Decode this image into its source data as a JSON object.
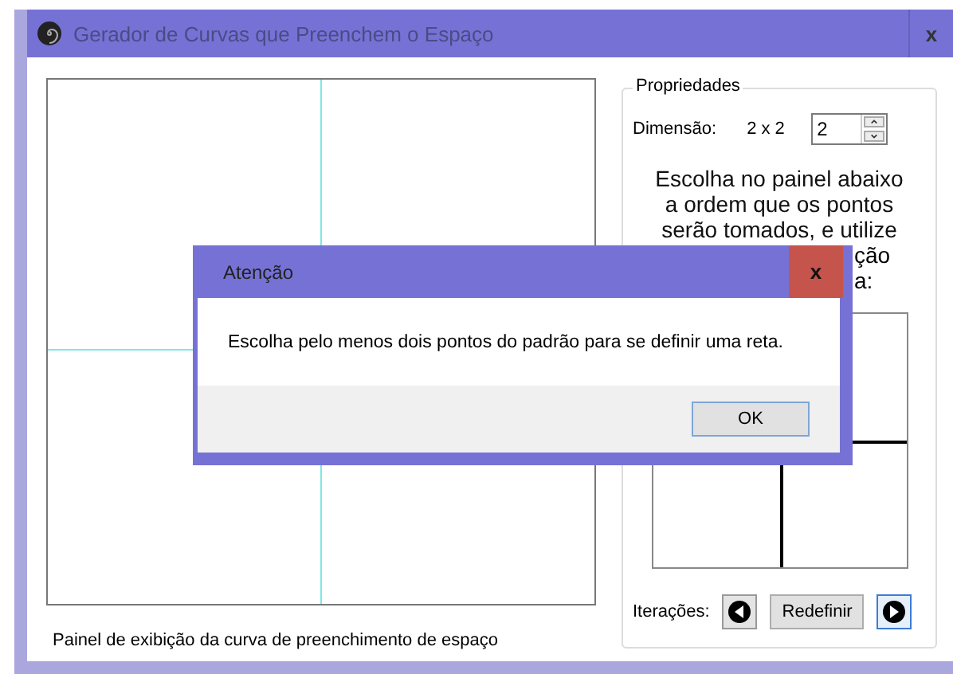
{
  "window": {
    "title": "Gerador de Curvas que Preenchem o Espaço",
    "close": "x"
  },
  "display_panel": {
    "caption": "Painel de exibição da curva de preenchimento de espaço"
  },
  "properties": {
    "title": "Propriedades",
    "dimension_label": "Dimensão:",
    "dimension_value": "2 x 2",
    "spinner_value": "2",
    "instructions": [
      "Escolha no painel abaixo",
      "a ordem que os pontos",
      "serão tomados, e utilize"
    ],
    "instruction_fragments": [
      "ção",
      "a:"
    ],
    "iterations_label": "Iterações:",
    "reset_button": "Redefinir"
  },
  "dialog": {
    "title": "Atenção",
    "close": "x",
    "message": "Escolha pelo menos dois pontos do padrão para se definir uma reta.",
    "ok_button": "OK"
  }
}
